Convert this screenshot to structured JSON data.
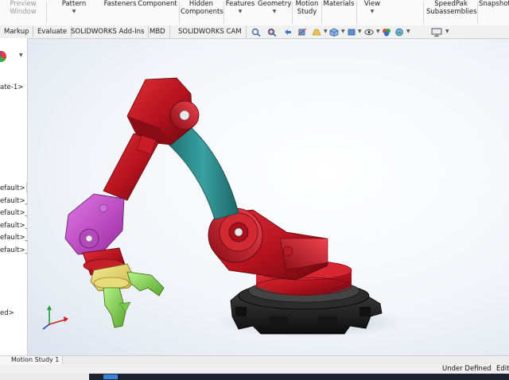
{
  "ribbon": {
    "preview_window": {
      "line1": "Preview",
      "line2": "Window"
    },
    "pattern": {
      "line1": "Pattern"
    },
    "fasteners": {
      "line1": "Fasteners"
    },
    "component": {
      "line1": "Component"
    },
    "hidden_components": {
      "line1": "Hidden",
      "line2": "Components"
    },
    "features": {
      "line1": "Features"
    },
    "geometry": {
      "line1": "Geometry"
    },
    "motion_study": {
      "line1": "Motion",
      "line2": "Study"
    },
    "materials": {
      "line1": "Materials"
    },
    "view": {
      "line1": "View"
    },
    "speedpak": {
      "line1": "SpeedPak",
      "line2": "Subassemblies"
    },
    "snapshot": {
      "line1": "Snapshot"
    }
  },
  "command_tabs": [
    "Markup",
    "Evaluate",
    "SOLIDWORKS Add-Ins",
    "MBD",
    "SOLIDWORKS CAM"
  ],
  "feature_tree": {
    "items": [
      "ate-1>",
      "efault>",
      "efault>_",
      "efault>_",
      "efault>_",
      "efault>_",
      "efault>_",
      "ed>"
    ]
  },
  "bottom_tabs": {
    "motion_study": "Motion Study 1"
  },
  "status_bar": {
    "state": "Under Defined",
    "mode": "Editi"
  },
  "colors": {
    "arm_red": "#b3121e",
    "link_teal": "#2f8c8c",
    "wrist_magenta": "#c348cc",
    "gripper_yellow": "#e6d76a",
    "finger_green": "#8ee05a",
    "base_black": "#1b1b1b"
  },
  "icons": [
    "zoom-to-fit-icon",
    "zoom-area-icon",
    "previous-view-icon",
    "section-view-icon",
    "dynamic-annotation-icon",
    "view-orientation-icon",
    "display-style-icon",
    "hide-show-icon",
    "edit-appearance-icon",
    "scene-icon",
    "view-settings-icon",
    "triad-icon"
  ]
}
